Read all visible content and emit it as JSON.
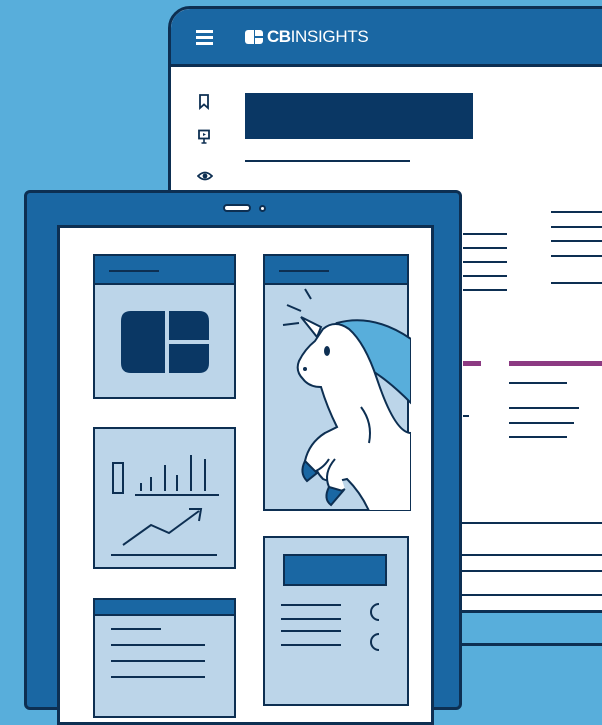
{
  "brand": {
    "bold": "CB",
    "light": "INSIGHTS"
  },
  "colors": {
    "background": "#58aedb",
    "primary": "#1a67a3",
    "navy": "#0a3764",
    "outline": "#0d2f52",
    "card_fill": "#bcd5e9",
    "accent_purple": "#8c3a82"
  },
  "icons": {
    "menu": "hamburger-menu-icon",
    "bookmark": "bookmark-icon",
    "presentation": "presentation-icon",
    "watch": "eye-icon",
    "logo": "cb-logo-icon",
    "unicorn": "unicorn-icon",
    "chart": "bar-chart-icon",
    "trend": "trend-arrow-icon",
    "progress": "loading-ring-icon"
  }
}
